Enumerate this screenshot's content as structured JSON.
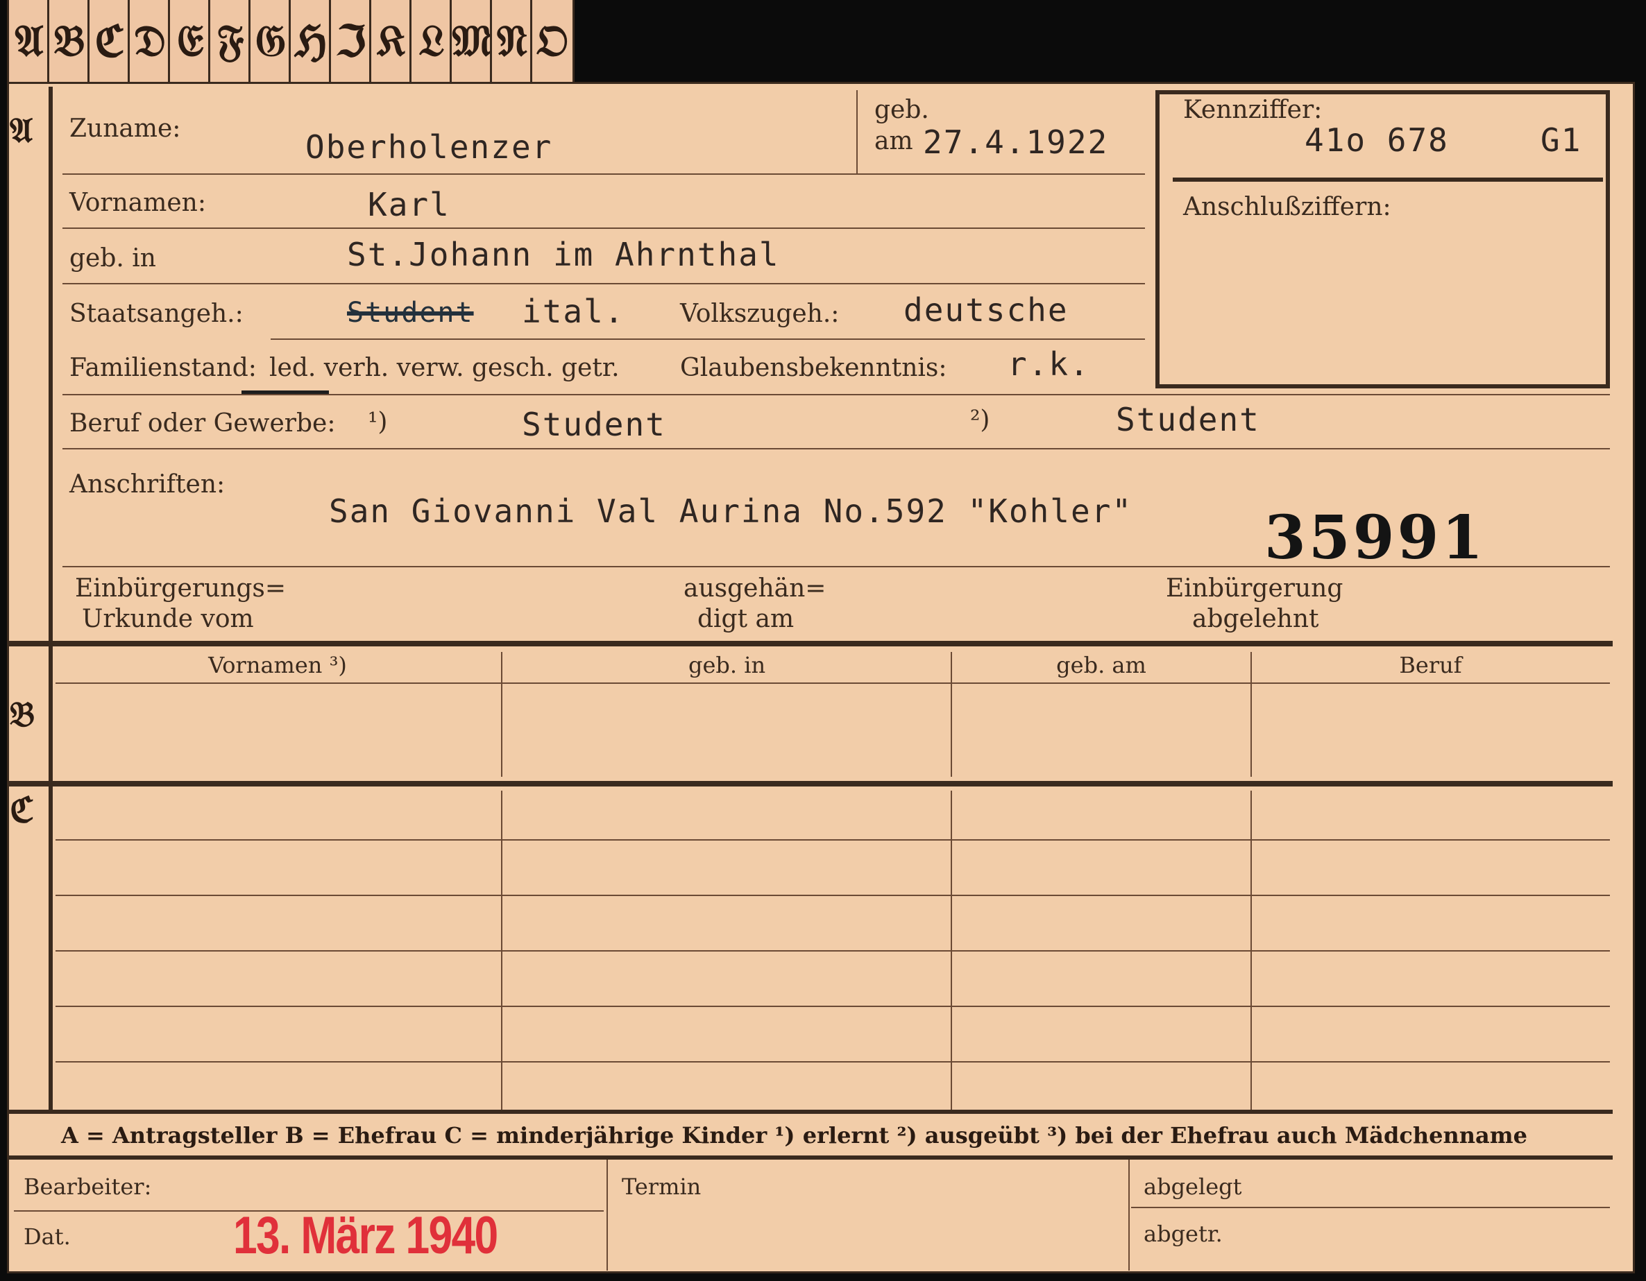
{
  "tabs": [
    "𝔄",
    "𝔅",
    "ℭ",
    "𝔇",
    "𝔈",
    "𝔉",
    "𝔊",
    "ℌ",
    "ℑ",
    "𝔎",
    "𝔏",
    "𝔐",
    "𝔑",
    "𝔒"
  ],
  "sections": {
    "a": "𝔄",
    "b": "𝔅",
    "c": "ℭ"
  },
  "labels": {
    "zuname": "Zuname:",
    "geb": "geb.",
    "am": "am",
    "kennziffer": "Kennziffer:",
    "vornamen": "Vornamen:",
    "anschlussziffern": "Anschlußziffern:",
    "geb_in": "geb. in",
    "staatsangeh": "Staatsangeh.:",
    "volkszugeh": "Volkszugeh.:",
    "familienstand": "Familienstand:",
    "familienstand_options": "led. verh. verw. gesch. getr.",
    "glaubensbekenntnis": "Glaubensbekenntnis:",
    "beruf": "Beruf oder Gewerbe:",
    "fn1": "¹)",
    "fn2": "²)",
    "anschriften": "Anschriften:",
    "einbuergerung1": "Einbürgerungs=",
    "einbuergerung2": "Urkunde vom",
    "ausgehaen1": "ausgehän=",
    "ausgehaen2": "digt am",
    "abgelehnt1": "Einbürgerung",
    "abgelehnt2": "abgelehnt",
    "col_vornamen": "Vornamen ³)",
    "col_geb_in": "geb. in",
    "col_geb_am": "geb. am",
    "col_beruf": "Beruf",
    "legend": "A = Antragsteller   B = Ehefrau   C = minderjährige Kinder   ¹) erlernt   ²) ausgeübt   ³) bei der Ehefrau auch Mädchenname",
    "bearbeiter": "Bearbeiter:",
    "termin": "Termin",
    "abgelegt": "abgelegt",
    "dat": "Dat.",
    "abgetr": "abgetr."
  },
  "values": {
    "zuname": "Oberholenzer",
    "geb_am": "27.4.1922",
    "kennziffer": "41o 678",
    "kennziffer_suffix": "G1",
    "vornamen": "Karl",
    "geb_in": "St.Johann im Ahrnthal",
    "staatsangeh_struck": "Student",
    "staatsangeh": "ital.",
    "volkszugeh": "deutsche",
    "glaubensbekenntnis": "r.k.",
    "beruf_erlernt": "Student",
    "beruf_ausgeuebt": "Student",
    "anschrift": "San Giovanni Val Aurina No.592 \"Kohler\"",
    "stamp_number": "35991",
    "date_stamp": "13. März 1940"
  }
}
